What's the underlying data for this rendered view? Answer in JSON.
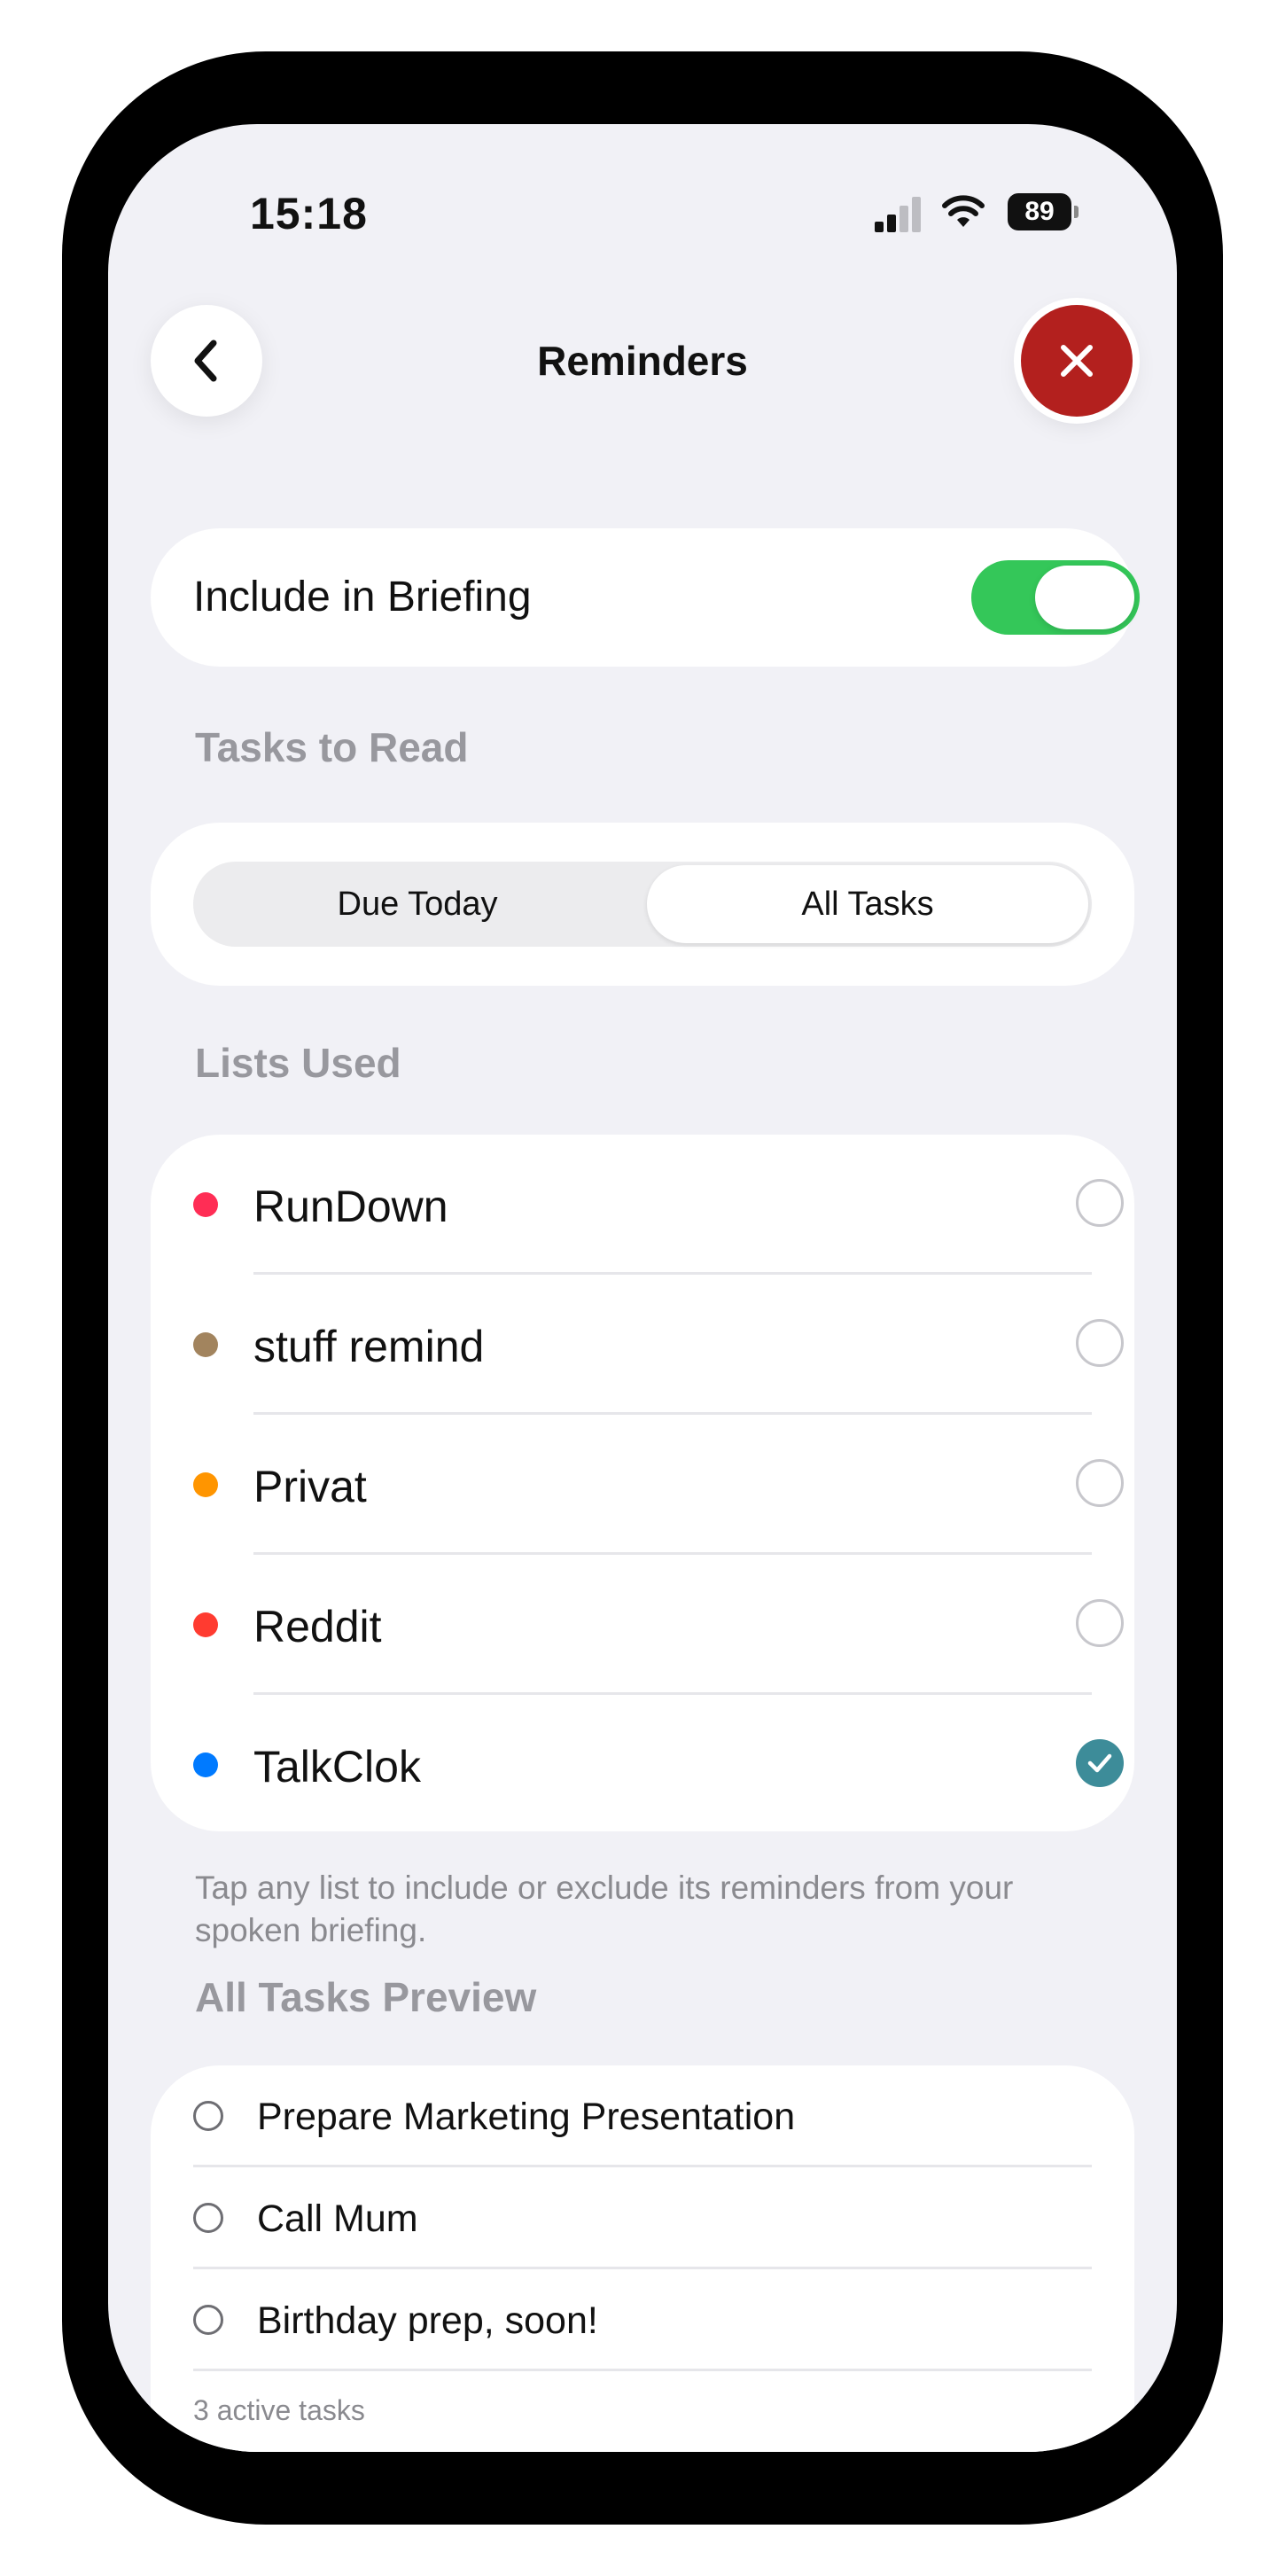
{
  "status_bar": {
    "time": "15:18",
    "battery": "89"
  },
  "nav": {
    "title": "Reminders",
    "back_icon": "chevron-left-icon",
    "close_icon": "xmark-icon"
  },
  "briefing_toggle": {
    "label": "Include in Briefing",
    "on": true
  },
  "tasks_to_read": {
    "header": "Tasks to Read",
    "options": [
      "Due Today",
      "All Tasks"
    ],
    "selected": "All Tasks"
  },
  "lists_used": {
    "header": "Lists Used",
    "items": [
      {
        "name": "RunDown",
        "color": "#ff2d55",
        "selected": false
      },
      {
        "name": "stuff remind",
        "color": "#a2845e",
        "selected": false
      },
      {
        "name": "Privat",
        "color": "#ff9500",
        "selected": false
      },
      {
        "name": "Reddit",
        "color": "#ff3b30",
        "selected": false
      },
      {
        "name": "TalkClok",
        "color": "#007aff",
        "selected": true
      }
    ],
    "footnote": "Tap any list to include or exclude its reminders from your spoken briefing."
  },
  "preview": {
    "header": "All Tasks Preview",
    "tasks": [
      "Prepare Marketing Presentation",
      "Call Mum",
      "Birthday prep, soon!"
    ],
    "count_label": "3 active tasks"
  },
  "colors": {
    "toggle_on": "#34c759",
    "close_button": "#b3201e",
    "checked": "#3d8c99"
  }
}
